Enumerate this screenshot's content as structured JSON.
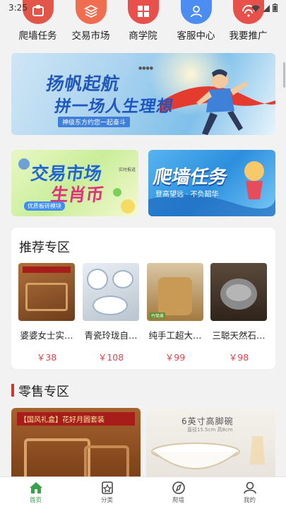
{
  "status": {
    "time": "3:25"
  },
  "categories": [
    {
      "label": "爬墙任务",
      "icon": "task-icon",
      "color": "#e2564a"
    },
    {
      "label": "交易市场",
      "icon": "layers-icon",
      "color": "#f06d4f"
    },
    {
      "label": "商学院",
      "icon": "grid-icon",
      "color": "#e9504c"
    },
    {
      "label": "客服中心",
      "icon": "user-icon",
      "color": "#4c8df2"
    },
    {
      "label": "我要推广",
      "icon": "signal-icon",
      "color": "#e8504b"
    }
  ],
  "banner": {
    "line1": "扬帆起航",
    "line2": "拼一场人生理想",
    "subtitle": "神级东方约您一起奋斗"
  },
  "promos": {
    "left": {
      "line1": "交易市场",
      "line2": "生肖币",
      "tag": "实时报道",
      "chip": "优质板砖模块"
    },
    "right": {
      "line1": "爬墙任务",
      "line2": "登高望远 · 不负韶华"
    }
  },
  "recommend": {
    "title": "推荐专区",
    "items": [
      {
        "name": "婆婆女士实…",
        "price": "￥38"
      },
      {
        "name": "青瓷玲珑自…",
        "price": "￥108"
      },
      {
        "name": "纯手工超大…",
        "price": "￥99"
      },
      {
        "name": "三聪天然石…",
        "price": "￥98"
      }
    ]
  },
  "retail": {
    "title": "零售专区",
    "left_caption": "【国风礼盒】花好月圆套装",
    "right_caption": "6英寸高脚碗",
    "right_caption_sub": "直径15.5cm 高8cm"
  },
  "bottom_nav": [
    {
      "label": "首页",
      "icon": "home-icon",
      "active": true
    },
    {
      "label": "分类",
      "icon": "category-icon",
      "active": false
    },
    {
      "label": "爬墙",
      "icon": "compass-icon",
      "active": false
    },
    {
      "label": "我的",
      "icon": "profile-icon",
      "active": false
    }
  ],
  "colors": {
    "accent_green": "#3aa14a",
    "price_red": "#e2424c",
    "section_bar": "#c83a2c"
  }
}
